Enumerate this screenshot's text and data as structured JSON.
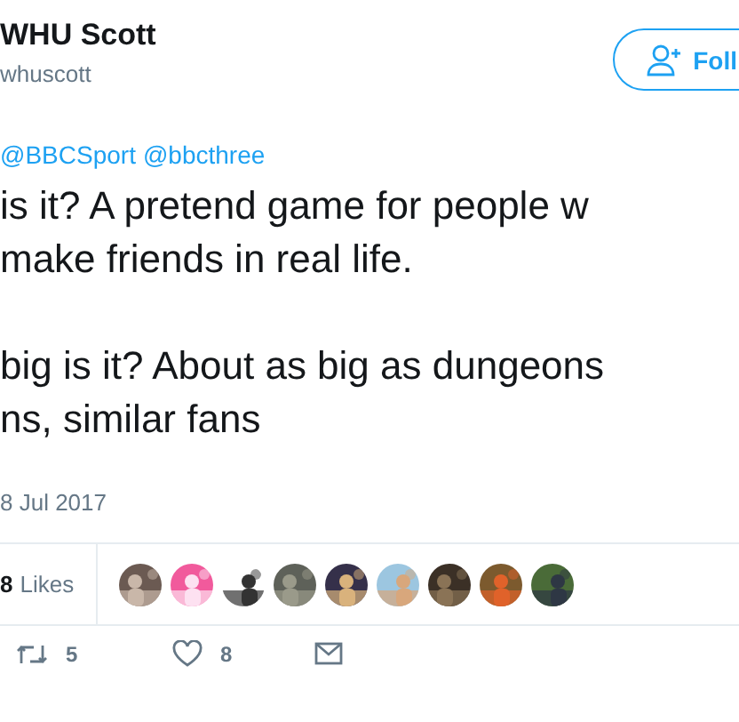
{
  "author": {
    "name": "WHU Scott",
    "handle": "whuscott"
  },
  "follow_button": {
    "label": "Foll"
  },
  "reply_to": [
    "@BBCSport",
    "@bbcthree"
  ],
  "paragraphs": [
    "is it? A pretend game for people w\nmake friends in real life.",
    "big is it? About as big as dungeons\nns, similar fans"
  ],
  "date": "8 Jul 2017",
  "likes": {
    "count": "8",
    "label": "Likes"
  },
  "actions": [
    {
      "kind": "retweet",
      "count": "5"
    },
    {
      "kind": "like",
      "count": "8"
    },
    {
      "kind": "message"
    }
  ]
}
